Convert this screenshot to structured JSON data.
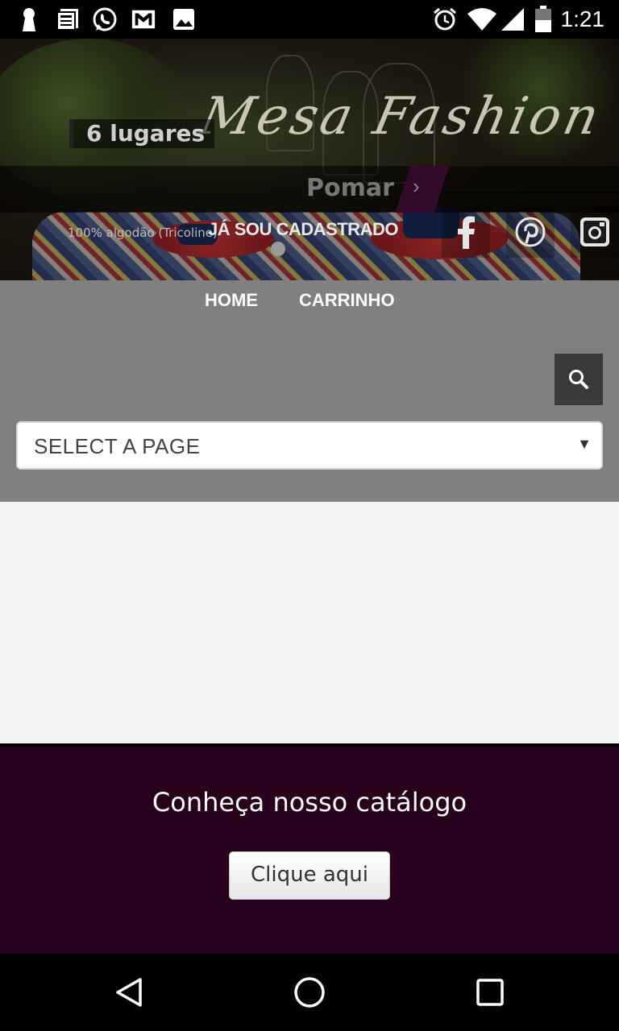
{
  "status_bar": {
    "time": "1:21",
    "left_icons": [
      "keyhole-icon",
      "news-icon",
      "whatsapp-icon",
      "gmail-icon",
      "image-icon"
    ],
    "right_icons": [
      "alarm-icon",
      "wifi-icon",
      "signal-icon",
      "battery-icon"
    ]
  },
  "hero": {
    "logo": "Mesa Fashion",
    "slide": {
      "tag": "6 lugares",
      "title": "Pomar",
      "next_symbol": "›",
      "subtitle": "100% algodão (Tricoline)"
    },
    "login_link": "JÁ SOU CADASTRADO",
    "social": [
      "facebook-icon",
      "pinterest-icon",
      "instagram-icon"
    ]
  },
  "nav": {
    "links": [
      "HOME",
      "CARRINHO"
    ],
    "select_placeholder": "SELECT A PAGE",
    "select_arrow": "▼"
  },
  "catalog": {
    "title": "Conheça nosso catálogo",
    "button": "Clique aqui",
    "background": "#27001b"
  },
  "system_nav": [
    "back-icon",
    "home-icon",
    "recents-icon"
  ]
}
